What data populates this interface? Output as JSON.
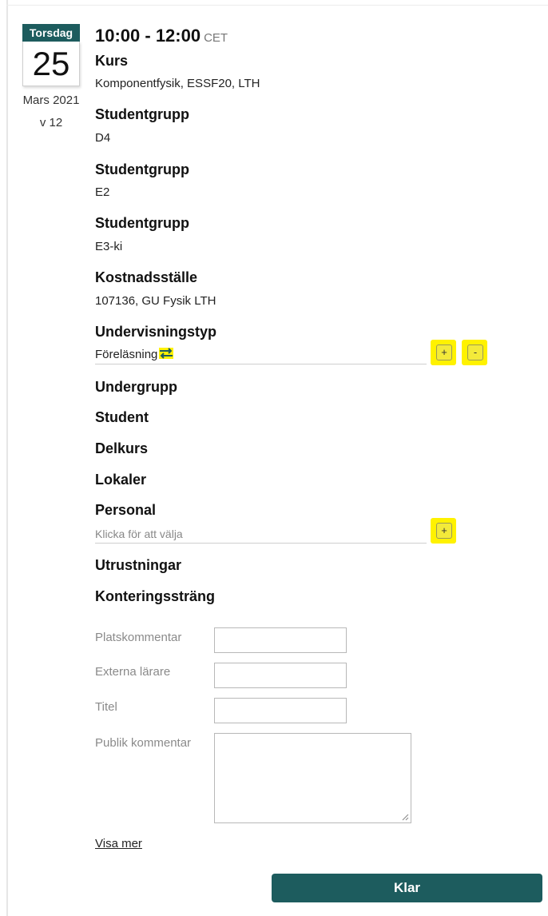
{
  "calendar": {
    "weekday": "Torsdag",
    "day": "25",
    "month_year": "Mars 2021",
    "week": "v 12"
  },
  "time": {
    "range": "10:00 - 12:00",
    "timezone": "CET"
  },
  "fields": {
    "course": {
      "label": "Kurs",
      "value": "Komponentfysik, ESSF20, LTH"
    },
    "studentgroup_1": {
      "label": "Studentgrupp",
      "value": "D4"
    },
    "studentgroup_2": {
      "label": "Studentgrupp",
      "value": "E2"
    },
    "studentgroup_3": {
      "label": "Studentgrupp",
      "value": "E3-ki"
    },
    "cost_center": {
      "label": "Kostnadsställe",
      "value": "107136, GU Fysik LTH"
    },
    "teaching_type": {
      "label": "Undervisningstyp",
      "value": "Föreläsning"
    },
    "subgroup": {
      "label": "Undergrupp"
    },
    "student": {
      "label": "Student"
    },
    "subcourse": {
      "label": "Delkurs"
    },
    "rooms": {
      "label": "Lokaler"
    },
    "staff": {
      "label": "Personal",
      "placeholder": "Klicka för att välja"
    },
    "equipment": {
      "label": "Utrustningar"
    },
    "account_string": {
      "label": "Konteringssträng"
    }
  },
  "buttons": {
    "add": "+",
    "remove": "-",
    "done": "Klar"
  },
  "form": {
    "place_comment": {
      "label": "Platskommentar",
      "value": ""
    },
    "external_teachers": {
      "label": "Externa lärare",
      "value": ""
    },
    "title": {
      "label": "Titel",
      "value": ""
    },
    "public_comment": {
      "label": "Publik kommentar",
      "value": ""
    }
  },
  "links": {
    "show_more": "Visa mer"
  },
  "icons": {
    "swap": "swap-arrows-icon"
  },
  "colors": {
    "accent": "#1d5c5e",
    "highlight": "#fff200"
  }
}
